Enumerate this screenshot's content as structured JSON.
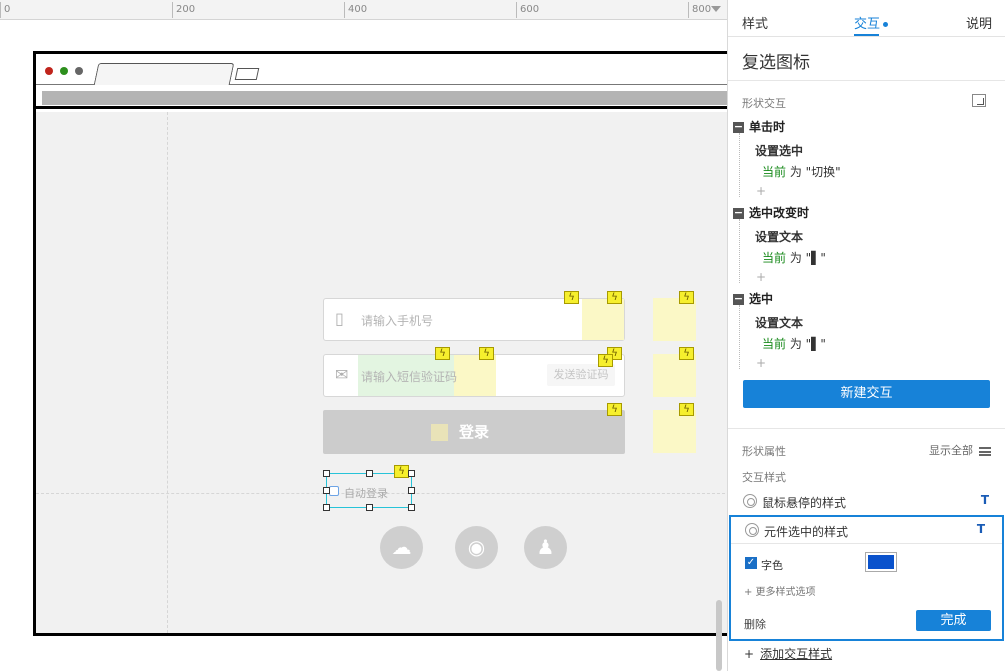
{
  "ruler": {
    "ticks": [
      "0",
      "200",
      "400",
      "600",
      "800"
    ]
  },
  "prototype": {
    "phone_placeholder": "请输入手机号",
    "sms_placeholder": "请输入短信验证码",
    "send_code_label": "发送验证码",
    "login_label": "登录",
    "auto_login_label": "自动登录",
    "traffic_light_colors": [
      "#c0241c",
      "#2d8f1d",
      "#666666"
    ],
    "social_icons": [
      "wechat-icon",
      "weibo-icon",
      "qq-icon"
    ]
  },
  "panel": {
    "tabs": [
      "样式",
      "交互",
      "说明"
    ],
    "active_tab": "交互",
    "title": "复选图标",
    "shape_interactions_label": "形状交互",
    "events": [
      {
        "name": "单击时",
        "action": "设置选中",
        "target": "当前",
        "text": "为 \"切换\""
      },
      {
        "name": "选中改变时",
        "action": "设置文本",
        "target": "当前",
        "text": "为 \"▌\""
      },
      {
        "name": "选中",
        "action": "设置文本",
        "target": "当前",
        "text": "为 \"▌\""
      }
    ],
    "add_action": "+",
    "new_interaction_label": "新建交互",
    "shape_props_label": "形状属性",
    "show_all_label": "显示全部",
    "interaction_styles_label": "交互样式",
    "styles": [
      {
        "label": "鼠标悬停的样式",
        "t": "T"
      },
      {
        "label": "元件选中的样式",
        "t": "T"
      }
    ],
    "selected_style": {
      "checkbox_label": "字色",
      "checked": true,
      "color": "#0a52cc",
      "more_options": "+ 更多样式选项",
      "delete_label": "删除",
      "done_label": "完成"
    },
    "add_style_label": "添加交互样式",
    "accent_color": "#1782d8"
  }
}
